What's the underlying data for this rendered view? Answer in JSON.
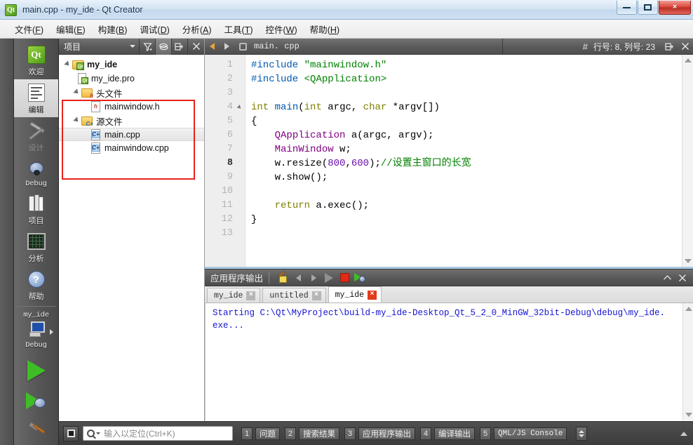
{
  "window": {
    "title": "main.cpp - my_ide - Qt Creator",
    "app_icon": "qt-logo-icon",
    "minimize": "minimize-icon",
    "maximize": "maximize-icon",
    "close": "×"
  },
  "menubar": [
    {
      "label": "文件",
      "accel": "F"
    },
    {
      "label": "编辑",
      "accel": "E"
    },
    {
      "label": "构建",
      "accel": "B"
    },
    {
      "label": "调试",
      "accel": "D"
    },
    {
      "label": "分析",
      "accel": "A"
    },
    {
      "label": "工具",
      "accel": "T"
    },
    {
      "label": "控件",
      "accel": "W"
    },
    {
      "label": "帮助",
      "accel": "H"
    }
  ],
  "sidebar": {
    "modes": [
      {
        "label": "欢迎",
        "icon": "qt-welcome-icon",
        "state": "normal"
      },
      {
        "label": "编辑",
        "icon": "edit-icon",
        "state": "active"
      },
      {
        "label": "设计",
        "icon": "design-icon",
        "state": "disabled"
      },
      {
        "label": "Debug",
        "icon": "debug-bug-icon",
        "state": "normal"
      },
      {
        "label": "项目",
        "icon": "projects-books-icon",
        "state": "normal"
      },
      {
        "label": "分析",
        "icon": "analyze-grid-icon",
        "state": "normal"
      },
      {
        "label": "帮助",
        "icon": "help-question-icon",
        "state": "normal"
      }
    ],
    "kit": {
      "project_name": "my_ide",
      "build_config": "Debug",
      "icon": "target-selector-icon"
    },
    "actions": [
      {
        "name": "run-button",
        "icon": "run-green-triangle-icon"
      },
      {
        "name": "start-debugging-button",
        "icon": "run-debug-icon"
      },
      {
        "name": "build-button",
        "icon": "hammer-build-icon"
      }
    ]
  },
  "tree_panel": {
    "combo_label": "项目",
    "toolbar": [
      {
        "name": "filter-tree-button",
        "icon": "filter-funnel-icon"
      },
      {
        "name": "synchronize-button",
        "icon": "link-sync-icon"
      },
      {
        "name": "split-button",
        "icon": "split-icon"
      },
      {
        "name": "close-sidebar-button",
        "icon": "close-icon"
      }
    ],
    "nodes": [
      {
        "label": "my_ide",
        "icon": "qt-project-folder-icon",
        "depth": 0,
        "expandable": true,
        "bold": true,
        "selected": false
      },
      {
        "label": "my_ide.pro",
        "icon": "qt-pro-file-icon",
        "depth": 1,
        "expandable": false,
        "bold": false,
        "selected": false
      },
      {
        "label": "头文件",
        "icon": "header-folder-icon",
        "depth": 1,
        "expandable": true,
        "bold": false,
        "selected": false
      },
      {
        "label": "mainwindow.h",
        "icon": "h-file-icon",
        "depth": 2,
        "expandable": false,
        "bold": false,
        "selected": false
      },
      {
        "label": "源文件",
        "icon": "source-folder-icon",
        "depth": 1,
        "expandable": true,
        "bold": false,
        "selected": false
      },
      {
        "label": "main.cpp",
        "icon": "cpp-file-icon",
        "depth": 2,
        "expandable": false,
        "bold": false,
        "selected": true
      },
      {
        "label": "mainwindow.cpp",
        "icon": "cpp-file-icon",
        "depth": 2,
        "expandable": false,
        "bold": false,
        "selected": false
      }
    ],
    "annotation_color": "#e8231c"
  },
  "editor": {
    "toolbar": {
      "back": "back-arrow-icon",
      "forward": "forward-arrow-icon",
      "lock": "lock-icon",
      "filename": "main. cpp",
      "dropdown": "chevron-down-icon",
      "symbol_hash": "#",
      "position": "行号: 8, 列号: 23",
      "split": "split-icon",
      "close": "×"
    },
    "lines": [
      {
        "no": "1",
        "fold": false,
        "current": false,
        "tokens": [
          {
            "t": "#include ",
            "c": "pre"
          },
          {
            "t": "\"mainwindow.h\"",
            "c": "str"
          }
        ]
      },
      {
        "no": "2",
        "fold": false,
        "current": false,
        "tokens": [
          {
            "t": "#include ",
            "c": "pre"
          },
          {
            "t": "<QApplication>",
            "c": "str"
          }
        ]
      },
      {
        "no": "3",
        "fold": false,
        "current": false,
        "tokens": []
      },
      {
        "no": "4",
        "fold": true,
        "current": false,
        "tokens": [
          {
            "t": "int",
            "c": "type"
          },
          {
            "t": " ",
            "c": "plain"
          },
          {
            "t": "main",
            "c": "pre"
          },
          {
            "t": "(",
            "c": "plain"
          },
          {
            "t": "int",
            "c": "type"
          },
          {
            "t": " argc, ",
            "c": "plain"
          },
          {
            "t": "char",
            "c": "type"
          },
          {
            "t": " *argv[])",
            "c": "plain"
          }
        ]
      },
      {
        "no": "5",
        "fold": false,
        "current": false,
        "tokens": [
          {
            "t": "{",
            "c": "plain"
          }
        ]
      },
      {
        "no": "6",
        "fold": false,
        "current": false,
        "tokens": [
          {
            "t": "    ",
            "c": "plain"
          },
          {
            "t": "QApplication",
            "c": "cls"
          },
          {
            "t": " a(argc, argv);",
            "c": "plain"
          }
        ]
      },
      {
        "no": "7",
        "fold": false,
        "current": false,
        "tokens": [
          {
            "t": "    ",
            "c": "plain"
          },
          {
            "t": "MainWindow",
            "c": "cls"
          },
          {
            "t": " w;",
            "c": "plain"
          }
        ]
      },
      {
        "no": "8",
        "fold": false,
        "current": true,
        "tokens": [
          {
            "t": "    w.resize(",
            "c": "plain"
          },
          {
            "t": "800",
            "c": "num"
          },
          {
            "t": ",",
            "c": "plain"
          },
          {
            "t": "600",
            "c": "num"
          },
          {
            "t": ");",
            "c": "plain"
          },
          {
            "t": "//设置主窗口的长宽",
            "c": "cmt"
          }
        ]
      },
      {
        "no": "9",
        "fold": false,
        "current": false,
        "tokens": [
          {
            "t": "    w.show();",
            "c": "plain"
          }
        ]
      },
      {
        "no": "10",
        "fold": false,
        "current": false,
        "tokens": []
      },
      {
        "no": "11",
        "fold": false,
        "current": false,
        "tokens": [
          {
            "t": "    ",
            "c": "plain"
          },
          {
            "t": "return",
            "c": "type"
          },
          {
            "t": " a.exec();",
            "c": "plain"
          }
        ]
      },
      {
        "no": "12",
        "fold": false,
        "current": false,
        "tokens": [
          {
            "t": "}",
            "c": "plain"
          }
        ]
      },
      {
        "no": "13",
        "fold": false,
        "current": false,
        "tokens": []
      }
    ]
  },
  "output_pane": {
    "title": "应用程序输出",
    "toolbar": [
      {
        "name": "toggle-word-wrap-button",
        "icon": "pencil-note-icon"
      },
      {
        "name": "previous-item-button",
        "icon": "left-arrow-icon"
      },
      {
        "name": "next-item-button",
        "icon": "right-arrow-icon"
      },
      {
        "name": "rerun-button",
        "icon": "play-triangle-icon"
      },
      {
        "name": "stop-button",
        "icon": "stop-square-icon"
      },
      {
        "name": "rerun-debug-button",
        "icon": "run-debug-icon"
      }
    ],
    "maximize": "chevron-up-icon",
    "close": "×",
    "tabs": [
      {
        "label": "my_ide",
        "active": false,
        "close": "×"
      },
      {
        "label": "untitled",
        "active": false,
        "close": "×"
      },
      {
        "label": "my_ide",
        "active": true,
        "close": "×"
      }
    ],
    "text": "Starting C:\\Qt\\MyProject\\build-my_ide-Desktop_Qt_5_2_0_MinGW_32bit-Debug\\debug\\my_ide.exe...",
    "text_color": "#1414d2"
  },
  "statusbar": {
    "sidebar_toggle": "toggle-sidebar-icon",
    "locator_placeholder": "输入以定位(Ctrl+K)",
    "locator_value": "",
    "panes": [
      {
        "num": "1",
        "label": "问题",
        "mono": false,
        "active": false
      },
      {
        "num": "2",
        "label": "搜索结果",
        "mono": false,
        "active": false
      },
      {
        "num": "3",
        "label": "应用程序输出",
        "mono": false,
        "active": true
      },
      {
        "num": "4",
        "label": "编译输出",
        "mono": false,
        "active": false
      },
      {
        "num": "5",
        "label": "QML/JS Console",
        "mono": true,
        "active": false
      }
    ],
    "spin": "updown-spinner-icon",
    "resize_grip": "up-arrow-icon"
  }
}
